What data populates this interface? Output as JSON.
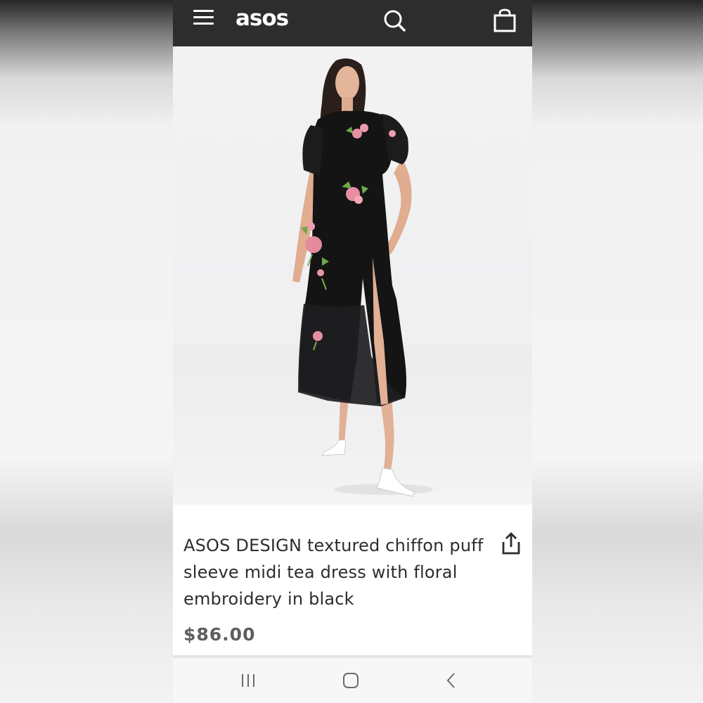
{
  "app": {
    "logo_text": "asos",
    "header_background": "#2d2d2d"
  },
  "header": {
    "icons": [
      "menu-icon",
      "search-icon",
      "bag-icon"
    ]
  },
  "product": {
    "image_alt": "Model wearing black chiffon midi tea dress with pink floral embroidery",
    "title": "ASOS DESIGN textured chiffon puff sleeve midi tea dress with floral embroidery in black",
    "price": "$86.00",
    "share_icon": "share-icon"
  },
  "system_nav": {
    "icons": [
      "recent-apps-icon",
      "home-icon",
      "back-icon"
    ]
  }
}
